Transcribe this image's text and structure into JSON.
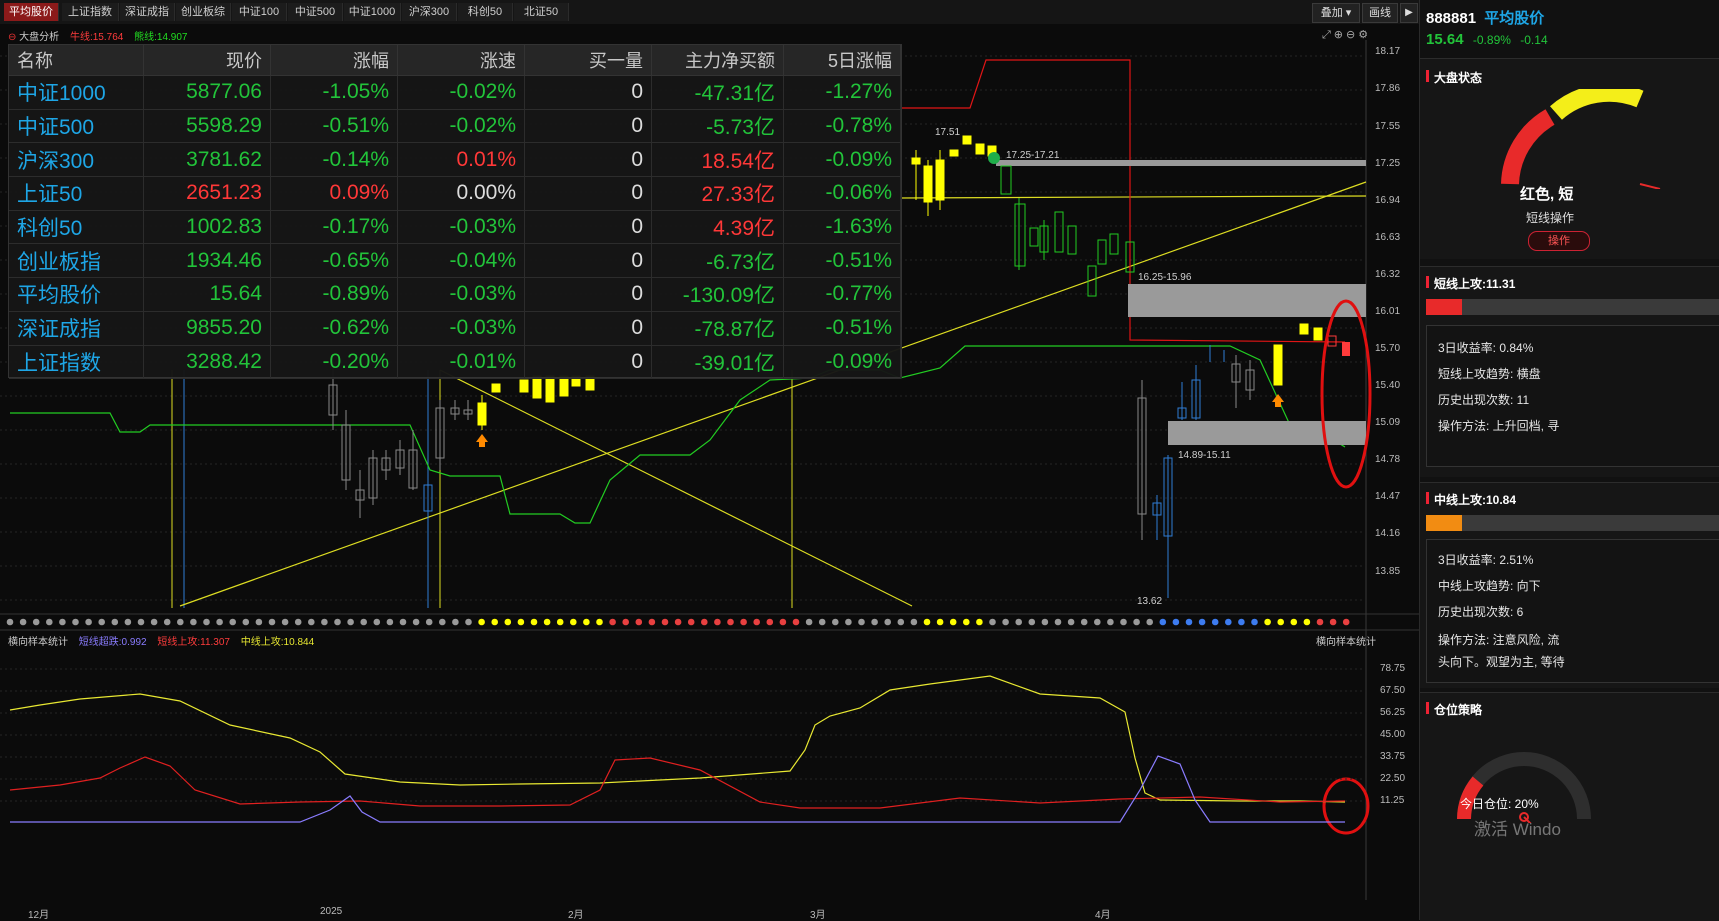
{
  "tabs": [
    "平均股价",
    "上证指数",
    "深证成指",
    "创业板综",
    "中证100",
    "中证500",
    "中证1000",
    "沪深300",
    "科创50",
    "北证50"
  ],
  "toolbar": {
    "overlay_label": "叠加",
    "draw_label": "画线"
  },
  "chart_header": {
    "title": "大盘分析",
    "bull_label": "牛线:15.764",
    "bear_label": "熊线:14.907"
  },
  "price_axis": [
    "18.17",
    "17.86",
    "17.55",
    "17.25",
    "16.94",
    "16.63",
    "16.32",
    "16.01",
    "15.70",
    "15.40",
    "15.09",
    "14.78",
    "14.47",
    "14.16",
    "13.85"
  ],
  "date_axis": [
    "12月",
    "2025",
    "2月",
    "3月",
    "4月"
  ],
  "annotations": {
    "high": "17.51",
    "zone_top": "17.25-17.21",
    "zone_mid": "16.25-15.96",
    "zone_low": "14.89-15.11",
    "low": "13.62"
  },
  "table": {
    "headers": [
      "名称",
      "现价",
      "涨幅",
      "涨速",
      "买一量",
      "主力净买额",
      "5日涨幅"
    ],
    "rows": [
      {
        "name": "中证1000",
        "price": "5877.06",
        "chg": "-1.05%",
        "speed": "-0.02%",
        "bid": "0",
        "net": "-47.31亿",
        "d5": "-1.27%",
        "c": [
          "g",
          "g",
          "g",
          "w",
          "g",
          "g"
        ]
      },
      {
        "name": "中证500",
        "price": "5598.29",
        "chg": "-0.51%",
        "speed": "-0.02%",
        "bid": "0",
        "net": "-5.73亿",
        "d5": "-0.78%",
        "c": [
          "g",
          "g",
          "g",
          "w",
          "g",
          "g"
        ]
      },
      {
        "name": "沪深300",
        "price": "3781.62",
        "chg": "-0.14%",
        "speed": "0.01%",
        "bid": "0",
        "net": "18.54亿",
        "d5": "-0.09%",
        "c": [
          "g",
          "g",
          "r",
          "w",
          "r",
          "g"
        ]
      },
      {
        "name": "上证50",
        "price": "2651.23",
        "chg": "0.09%",
        "speed": "0.00%",
        "bid": "0",
        "net": "27.33亿",
        "d5": "-0.06%",
        "c": [
          "r",
          "r",
          "w",
          "w",
          "r",
          "g"
        ]
      },
      {
        "name": "科创50",
        "price": "1002.83",
        "chg": "-0.17%",
        "speed": "-0.03%",
        "bid": "0",
        "net": "4.39亿",
        "d5": "-1.63%",
        "c": [
          "g",
          "g",
          "g",
          "w",
          "r",
          "g"
        ]
      },
      {
        "name": "创业板指",
        "price": "1934.46",
        "chg": "-0.65%",
        "speed": "-0.04%",
        "bid": "0",
        "net": "-6.73亿",
        "d5": "-0.51%",
        "c": [
          "g",
          "g",
          "g",
          "w",
          "g",
          "g"
        ]
      },
      {
        "name": "平均股价",
        "price": "15.64",
        "chg": "-0.89%",
        "speed": "-0.03%",
        "bid": "0",
        "net": "-130.09亿",
        "d5": "-0.77%",
        "c": [
          "g",
          "g",
          "g",
          "w",
          "g",
          "g"
        ]
      },
      {
        "name": "深证成指",
        "price": "9855.20",
        "chg": "-0.62%",
        "speed": "-0.03%",
        "bid": "0",
        "net": "-78.87亿",
        "d5": "-0.51%",
        "c": [
          "g",
          "g",
          "g",
          "w",
          "g",
          "g"
        ]
      },
      {
        "name": "上证指数",
        "price": "3288.42",
        "chg": "-0.20%",
        "speed": "-0.01%",
        "bid": "0",
        "net": "-39.01亿",
        "d5": "-0.09%",
        "c": [
          "g",
          "g",
          "g",
          "w",
          "g",
          "g"
        ]
      }
    ]
  },
  "sub_chart": {
    "title": "横向样本统计",
    "legend": [
      "短线超跌:0.992",
      "短线上攻:11.307",
      "中线上攻:10.844"
    ],
    "right_title": "横向样本统计",
    "axis": [
      "78.75",
      "67.50",
      "56.25",
      "45.00",
      "33.75",
      "22.50",
      "11.25"
    ]
  },
  "right_panel": {
    "code": "888881",
    "name": "平均股价",
    "price": "15.64",
    "chg": "-0.89%",
    "chg_abs": "-0.14",
    "market_state": {
      "title": "大盘状态",
      "label": "红色, 短",
      "sub": "短线操作",
      "button": "操作"
    },
    "short_attack": {
      "title": "短线上攻:11.31",
      "ret": "3日收益率: 0.84%",
      "trend": "短线上攻趋势: 横盘",
      "count": "历史出现次数: 11",
      "method": "操作方法: 上升回档, 寻"
    },
    "mid_attack": {
      "title": "中线上攻:10.84",
      "ret": "3日收益率: 2.51%",
      "trend": "中线上攻趋势: 向下",
      "count": "历史出现次数: 6",
      "method": "操作方法: 注意风险, 流",
      "method2": "头向下。观望为主, 等待"
    },
    "position": {
      "title": "仓位策略",
      "today": "今日仓位: 20%"
    },
    "watermark": "激活 Windo"
  },
  "colors": {
    "bull": "#ff2222",
    "bear": "#22dd22",
    "accent": "#1ea6e6",
    "yellow": "#ffff00"
  }
}
